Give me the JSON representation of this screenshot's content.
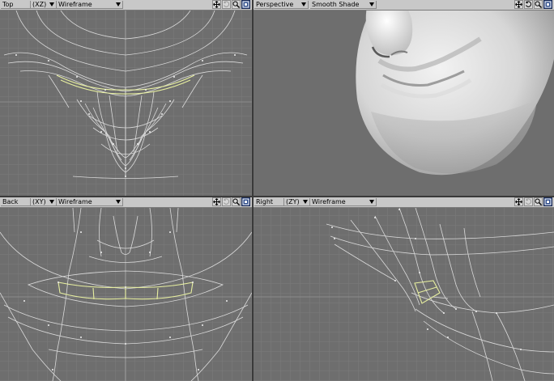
{
  "viewports": {
    "top": {
      "view": "Top",
      "axes": "(XZ)",
      "mode": "Wireframe"
    },
    "persp": {
      "view": "Perspective",
      "axes": "",
      "mode": "Smooth Shade"
    },
    "back": {
      "view": "Back",
      "axes": "(XY)",
      "mode": "Wireframe"
    },
    "right": {
      "view": "Right",
      "axes": "(ZY)",
      "mode": "Wireframe"
    }
  },
  "tools": [
    "move-view-icon",
    "rotate-view-icon",
    "zoom-view-icon",
    "maximize-view-icon"
  ],
  "colors": {
    "viewport_bg": "#6e6e6e",
    "grid_minor": "#7c7c7c",
    "grid_major": "#8a8a8a",
    "wire": "#e6e6e6",
    "selected_wire": "#e8f0a0",
    "header": "#c8c8c8",
    "active_tool": "#2d4b8a"
  }
}
